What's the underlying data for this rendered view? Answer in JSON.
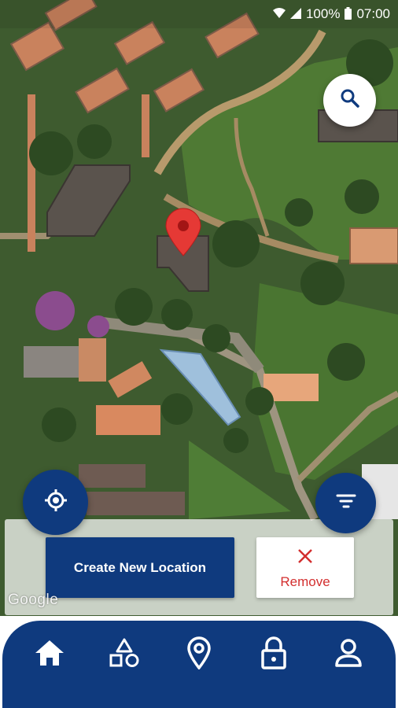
{
  "status_bar": {
    "battery": "100%",
    "time": "07:00",
    "icons": [
      "wifi-icon",
      "signal-icon",
      "battery-icon"
    ]
  },
  "map": {
    "attribution": "Google",
    "marker": "map-pin-icon"
  },
  "fabs": {
    "search": "search-icon",
    "locate": "my-location-icon",
    "filter": "filter-icon"
  },
  "actions": {
    "create_label": "Create New Location",
    "remove_label": "Remove",
    "remove_icon": "close-icon"
  },
  "nav": {
    "items": [
      {
        "icon": "home-icon"
      },
      {
        "icon": "categories-icon"
      },
      {
        "icon": "location-icon"
      },
      {
        "icon": "lock-icon"
      },
      {
        "icon": "profile-icon"
      }
    ]
  },
  "colors": {
    "primary": "#0f3a7e",
    "remove": "#d32f2f"
  }
}
